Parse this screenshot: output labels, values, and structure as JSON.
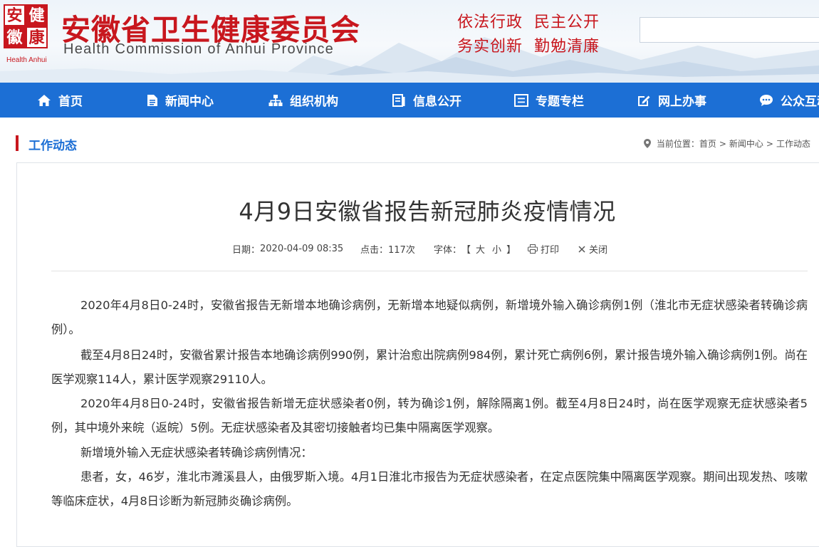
{
  "header": {
    "logo_chars": [
      "安",
      "健",
      "徽",
      "康"
    ],
    "logo_en": "Health Anhui",
    "title": "安徽省卫生健康委员会",
    "subtitle": "Health Commission of Anhui Province",
    "slogan_line1": "依法行政  民主公开",
    "slogan_line2": "务实创新  勤勉清廉",
    "search_value": ""
  },
  "nav": {
    "items": [
      {
        "label": "首页",
        "icon": "home-icon"
      },
      {
        "label": "新闻中心",
        "icon": "document-icon"
      },
      {
        "label": "组织机构",
        "icon": "org-chart-icon"
      },
      {
        "label": "信息公开",
        "icon": "info-icon"
      },
      {
        "label": "专题专栏",
        "icon": "column-icon"
      },
      {
        "label": "网上办事",
        "icon": "edit-icon"
      },
      {
        "label": "公众互动",
        "icon": "chat-icon"
      }
    ]
  },
  "section": {
    "title": "工作动态",
    "breadcrumb_prefix": "当前位置：",
    "breadcrumb": [
      "首页",
      "新闻中心",
      "工作动态"
    ],
    "breadcrumb_sep": ">"
  },
  "article": {
    "title": "4月9日安徽省报告新冠肺炎疫情情况",
    "date_label": "日期：",
    "date": "2020-04-09 08:35",
    "clicks_label": "点击：",
    "clicks": "117次",
    "font_label": "字体：",
    "bracket_open": "【",
    "font_large": "大",
    "font_small": "小",
    "bracket_close": "】",
    "print_label": "打印",
    "close_label": "关闭",
    "paragraphs": [
      "2020年4月8日0-24时，安徽省报告无新增本地确诊病例，无新增本地疑似病例，新增境外输入确诊病例1例（淮北市无症状感染者转确诊病例）。",
      "截至4月8日24时，安徽省累计报告本地确诊病例990例，累计治愈出院病例984例，累计死亡病例6例，累计报告境外输入确诊病例1例。尚在医学观察114人，累计医学观察29110人。",
      "2020年4月8日0-24时，安徽省报告新增无症状感染者0例，转为确诊1例，解除隔离1例。截至4月8日24时，尚在医学观察无症状感染者5例，其中境外来皖（返皖）5例。无症状感染者及其密切接触者均已集中隔离医学观察。",
      "新增境外输入无症状感染者转确诊病例情况：",
      "患者，女，46岁，淮北市濉溪县人，由俄罗斯入境。4月1日淮北市报告为无症状感染者，在定点医院集中隔离医学观察。期间出现发热、咳嗽等临床症状，4月8日诊断为新冠肺炎确诊病例。"
    ]
  },
  "colors": {
    "brand_red": "#c8171e",
    "nav_blue": "#1c6fd5",
    "text": "#333333"
  }
}
